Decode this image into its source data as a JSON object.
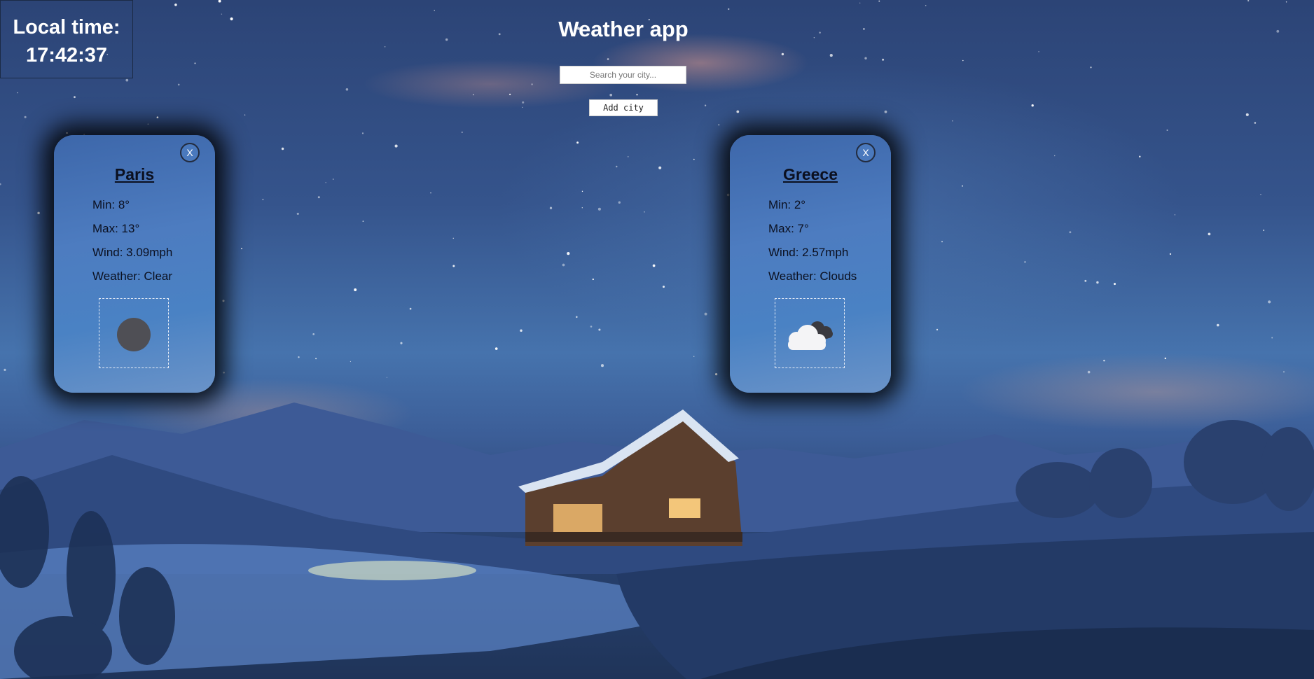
{
  "local_time": {
    "label": "Local time:",
    "value": "17:42:37"
  },
  "header": {
    "title": "Weather app"
  },
  "search": {
    "placeholder": "Search your city..."
  },
  "actions": {
    "add_city_label": "Add city"
  },
  "cards": [
    {
      "city": "Paris",
      "close_label": "X",
      "min": "Min: 8°",
      "max": "Max: 13°",
      "wind": "Wind: 3.09mph",
      "weather": "Weather: Clear",
      "icon": "clear-icon"
    },
    {
      "city": "Greece",
      "close_label": "X",
      "min": "Min: 2°",
      "max": "Max: 7°",
      "wind": "Wind: 2.57mph",
      "weather": "Weather: Clouds",
      "icon": "clouds-icon"
    }
  ],
  "colors": {
    "card_background": "#4a7cbf",
    "text_dark": "#0b1020",
    "title_white": "#ffffff"
  }
}
